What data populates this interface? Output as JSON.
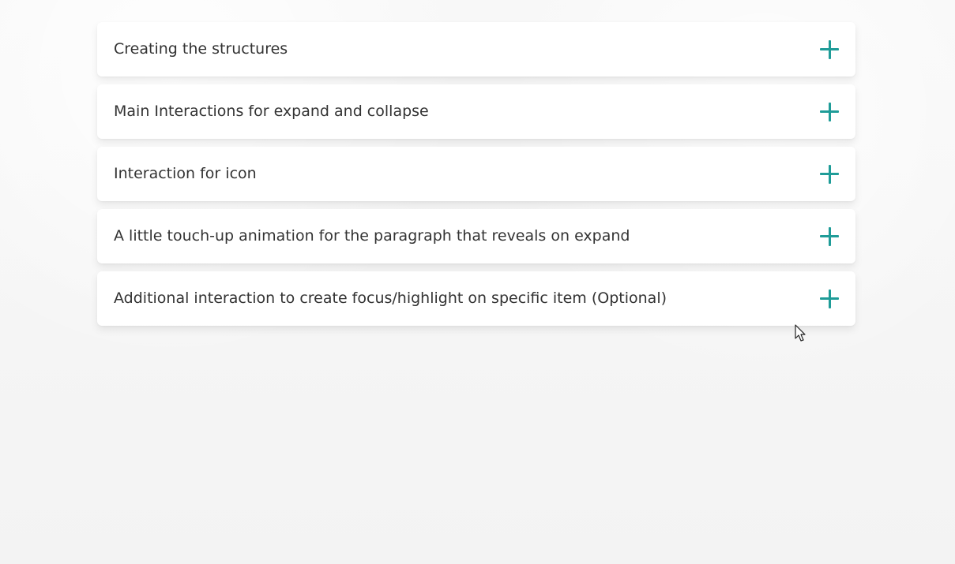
{
  "accordion": {
    "items": [
      {
        "title": "Creating the structures",
        "icon": "plus-icon"
      },
      {
        "title": "Main Interactions for expand and collapse",
        "icon": "plus-icon"
      },
      {
        "title": "Interaction for icon",
        "icon": "plus-icon"
      },
      {
        "title": "A little touch-up animation for the paragraph that reveals on expand",
        "icon": "plus-icon"
      },
      {
        "title": "Additional interaction to create focus/highlight on specific item (Optional)",
        "icon": "plus-icon"
      }
    ]
  },
  "colors": {
    "accent": "#1f9c98",
    "text": "#333333",
    "background": "#f7f7f7",
    "card": "#ffffff"
  },
  "cursor": {
    "icon": "mouse-pointer-icon"
  }
}
